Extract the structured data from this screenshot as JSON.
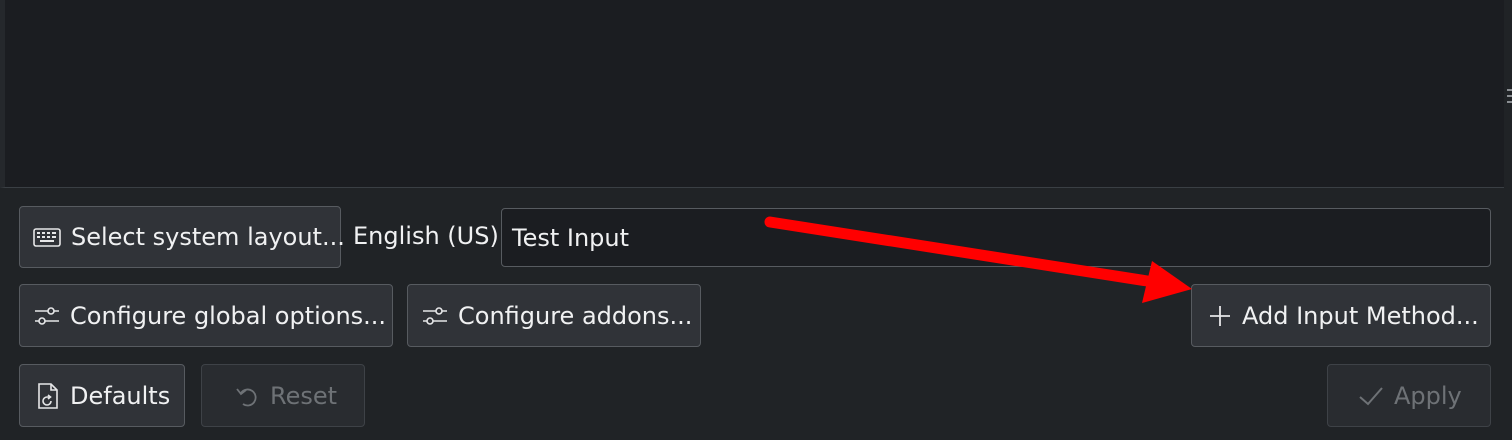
{
  "buttons": {
    "select_layout": "Select system layout...",
    "configure_global": "Configure global options...",
    "configure_addons": "Configure addons...",
    "add_input_method": "Add Input Method...",
    "defaults": "Defaults",
    "reset": "Reset",
    "apply": "Apply"
  },
  "layout_label": "English (US)",
  "test_input": {
    "value": "Test Input"
  },
  "annotation": {
    "color": "#ff0000"
  },
  "icons": {
    "select_layout": "keyboard-icon",
    "configure_global": "configure-icon",
    "configure_addons": "configure-icon",
    "add_input_method": "plus-icon",
    "defaults": "document-revert-icon",
    "reset": "undo-icon",
    "apply": "checkmark-icon"
  }
}
